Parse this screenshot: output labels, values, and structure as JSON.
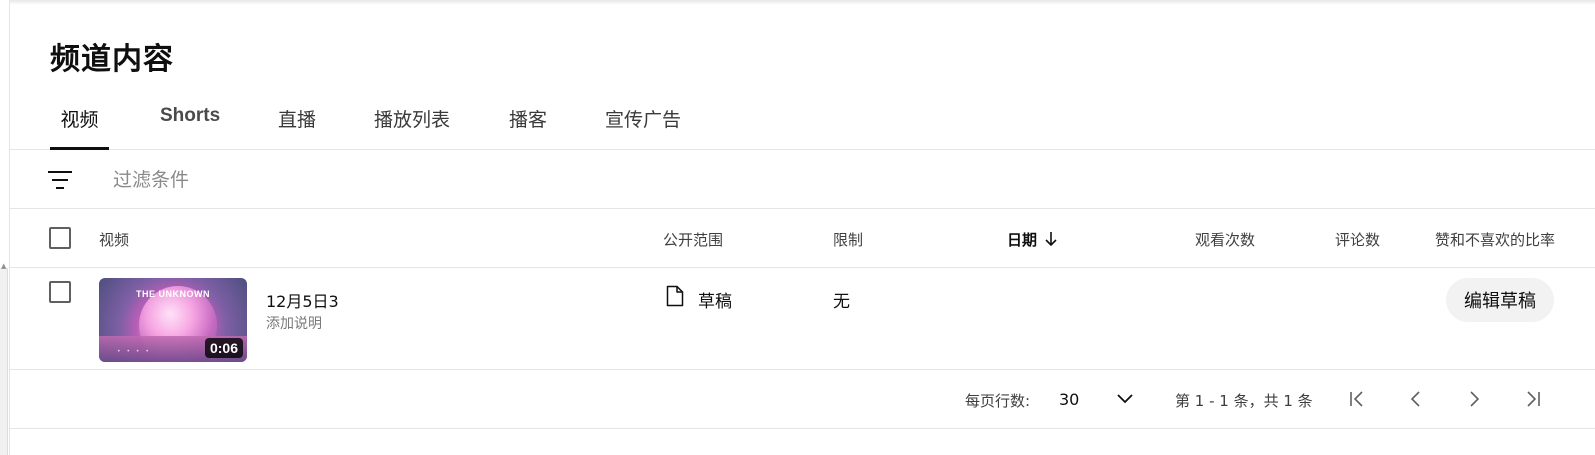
{
  "page": {
    "title": "频道内容"
  },
  "tabs": [
    {
      "label": "视频",
      "active": true
    },
    {
      "label": "Shorts",
      "active": false
    },
    {
      "label": "直播",
      "active": false
    },
    {
      "label": "播放列表",
      "active": false
    },
    {
      "label": "播客",
      "active": false
    },
    {
      "label": "宣传广告",
      "active": false
    }
  ],
  "filter": {
    "icon": "filter-icon",
    "placeholder": "过滤条件"
  },
  "table": {
    "headers": {
      "video": "视频",
      "visibility": "公开范围",
      "restrictions": "限制",
      "date": "日期",
      "views": "观看次数",
      "comments": "评论数",
      "likes_ratio": "赞和不喜欢的比率"
    },
    "sort": {
      "column": "date",
      "direction": "desc",
      "icon": "arrow-down-icon"
    },
    "rows": [
      {
        "thumbnail_title": "THE UNKNOWN",
        "duration": "0:06",
        "title": "12月5日3",
        "description": "添加说明",
        "visibility": "草稿",
        "visibility_icon": "draft-document-icon",
        "restrictions": "无",
        "action": "编辑草稿"
      }
    ]
  },
  "pagination": {
    "rows_per_page_label": "每页行数:",
    "rows_per_page": "30",
    "range": "第 1 - 1 条，共 1 条"
  },
  "colors": {
    "text": "#0f0f0f",
    "secondary_text": "#606060",
    "divider": "#e5e5e5",
    "button_bg": "#f2f2f2"
  }
}
